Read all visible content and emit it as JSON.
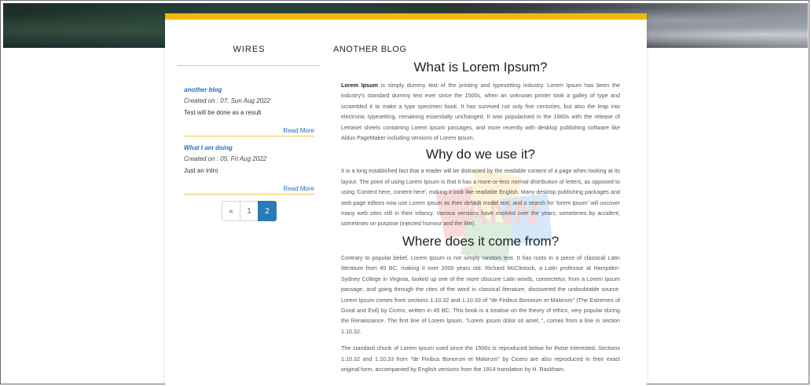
{
  "sidebar": {
    "title": "WIRES",
    "posts": [
      {
        "title": "another blog",
        "date": "Created on : 07, Sun Aug 2022",
        "excerpt": "Test will be done as a result",
        "read_more": "Read More"
      },
      {
        "title": "What I am doing",
        "date": "Created on : 05, Fri Aug 2022",
        "excerpt": "Just an intro",
        "read_more": "Read More"
      }
    ],
    "pagination": {
      "prev": "«",
      "pages": [
        "1",
        "2"
      ],
      "active": "2"
    }
  },
  "main": {
    "heading": "ANOTHER BLOG",
    "sections": [
      {
        "title": "What is Lorem Ipsum?",
        "lead_bold": "Lorem Ipsum",
        "text": " is simply dummy text of the printing and typesetting industry. Lorem Ipsum has been the industry's standard dummy text ever since the 1500s, when an unknown printer took a galley of type and scrambled it to make a type specimen book. It has survived not only five centuries, but also the leap into electronic typesetting, remaining essentially unchanged. It was popularised in the 1960s with the release of Letraset sheets containing Lorem Ipsum passages, and more recently with desktop publishing software like Aldus PageMaker including versions of Lorem Ipsum."
      },
      {
        "title": "Why do we use it?",
        "text": "It is a long established fact that a reader will be distracted by the readable content of a page when looking at its layout. The point of using Lorem Ipsum is that it has a more-or-less normal distribution of letters, as opposed to using 'Content here, content here', making it look like readable English. Many desktop publishing packages and web page editors now use Lorem Ipsum as their default model text, and a search for 'lorem ipsum' will uncover many web sites still in their infancy. Various versions have evolved over the years, sometimes by accident, sometimes on purpose (injected humour and the like)."
      },
      {
        "title": "Where does it come from?",
        "text": "Contrary to popular belief, Lorem Ipsum is not simply random text. It has roots in a piece of classical Latin literature from 45 BC, making it over 2000 years old. Richard McClintock, a Latin professor at Hampden-Sydney College in Virginia, looked up one of the more obscure Latin words, consectetur, from a Lorem Ipsum passage, and going through the cites of the word in classical literature, discovered the undoubtable source. Lorem Ipsum comes from sections 1.10.32 and 1.10.33 of \"de Finibus Bonorum et Malorum\" (The Extremes of Good and Evil) by Cicero, written in 45 BC. This book is a treatise on the theory of ethics, very popular during the Renaissance. The first line of Lorem Ipsum, \"Lorem ipsum dolor sit amet..\", comes from a line in section 1.10.32.",
        "text2": "The standard chunk of Lorem Ipsum used since the 1500s is reproduced below for those interested. Sections 1.10.32 and 1.10.33 from \"de Finibus Bonorum et Malorum\" by Cicero are also reproduced in their exact original form, accompanied by English versions from the 1914 translation by H. Rackham."
      }
    ]
  },
  "colors": {
    "accent": "#f2b90c",
    "link": "#2a6ebb",
    "active_page": "#2a7ab8"
  }
}
